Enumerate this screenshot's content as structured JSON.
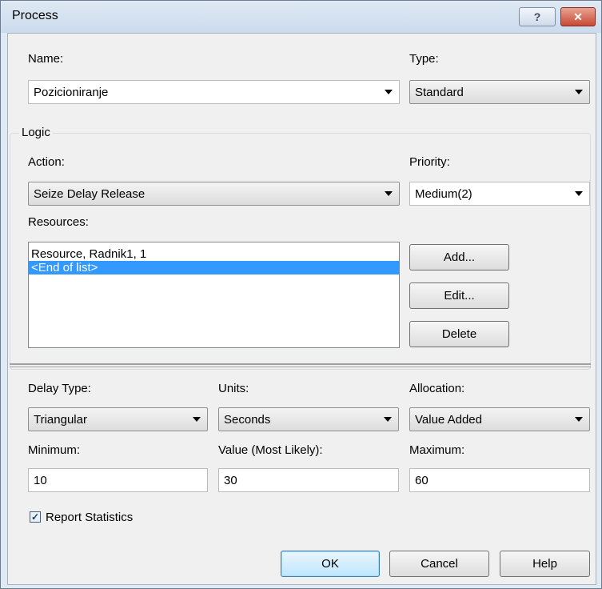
{
  "window": {
    "title": "Process",
    "help_glyph": "?",
    "close_glyph": "✕"
  },
  "name": {
    "label": "Name:",
    "value": "Pozicioniranje"
  },
  "type": {
    "label": "Type:",
    "value": "Standard"
  },
  "logic": {
    "group_label": "Logic",
    "action": {
      "label": "Action:",
      "value": "Seize Delay Release"
    },
    "priority": {
      "label": "Priority:",
      "value": "Medium(2)"
    },
    "resources": {
      "label": "Resources:",
      "items": [
        "Resource, Radnik1, 1",
        "<End of list>"
      ],
      "selected_index": 1
    },
    "buttons": {
      "add": "Add...",
      "edit": "Edit...",
      "delete": "Delete"
    }
  },
  "delay": {
    "delay_type": {
      "label": "Delay Type:",
      "value": "Triangular"
    },
    "units": {
      "label": "Units:",
      "value": "Seconds"
    },
    "allocation": {
      "label": "Allocation:",
      "value": "Value Added"
    },
    "minimum": {
      "label": "Minimum:",
      "value": "10"
    },
    "most_likely": {
      "label": "Value (Most Likely):",
      "value": "30"
    },
    "maximum": {
      "label": "Maximum:",
      "value": "60"
    }
  },
  "report_statistics": {
    "label": "Report Statistics",
    "checked": true,
    "check_glyph": "✓"
  },
  "footer": {
    "ok": "OK",
    "cancel": "Cancel",
    "help": "Help"
  }
}
